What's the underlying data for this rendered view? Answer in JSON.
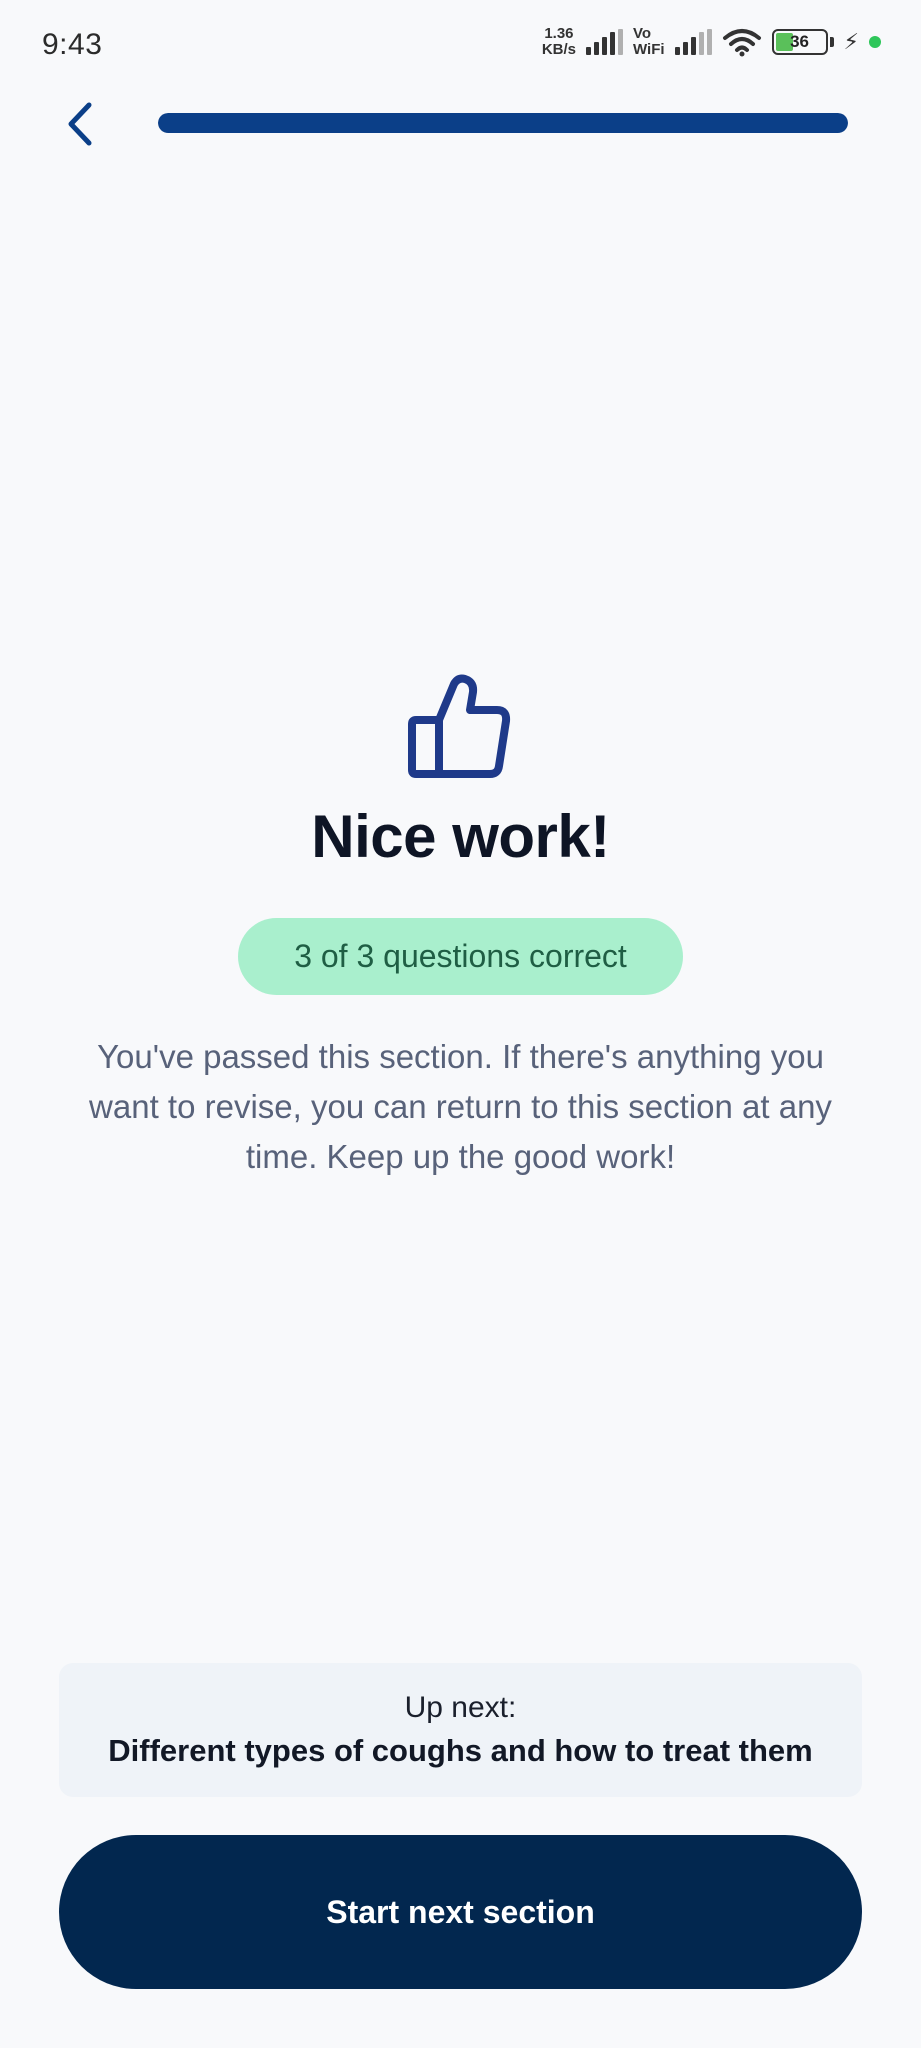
{
  "status_bar": {
    "time": "9:43",
    "net_speed_value": "1.36",
    "net_speed_unit": "KB/s",
    "vowifi_top": "Vo",
    "vowifi_bottom": "WiFi",
    "battery_level": "36"
  },
  "header": {
    "back_icon": "chevron-left-icon",
    "progress_fraction": 1.0,
    "progress_color": "#0b3f88"
  },
  "result": {
    "icon": "thumbs-up-icon",
    "title": "Nice work!",
    "score": "3 of 3 questions correct",
    "message": "You've passed this section. If there's anything you want to revise, you can return to this section at any time. Keep up the good work!"
  },
  "up_next": {
    "label": "Up next:",
    "title": "Different types of coughs and how to treat them"
  },
  "cta": {
    "label": "Start next section",
    "color": "#02274f"
  }
}
